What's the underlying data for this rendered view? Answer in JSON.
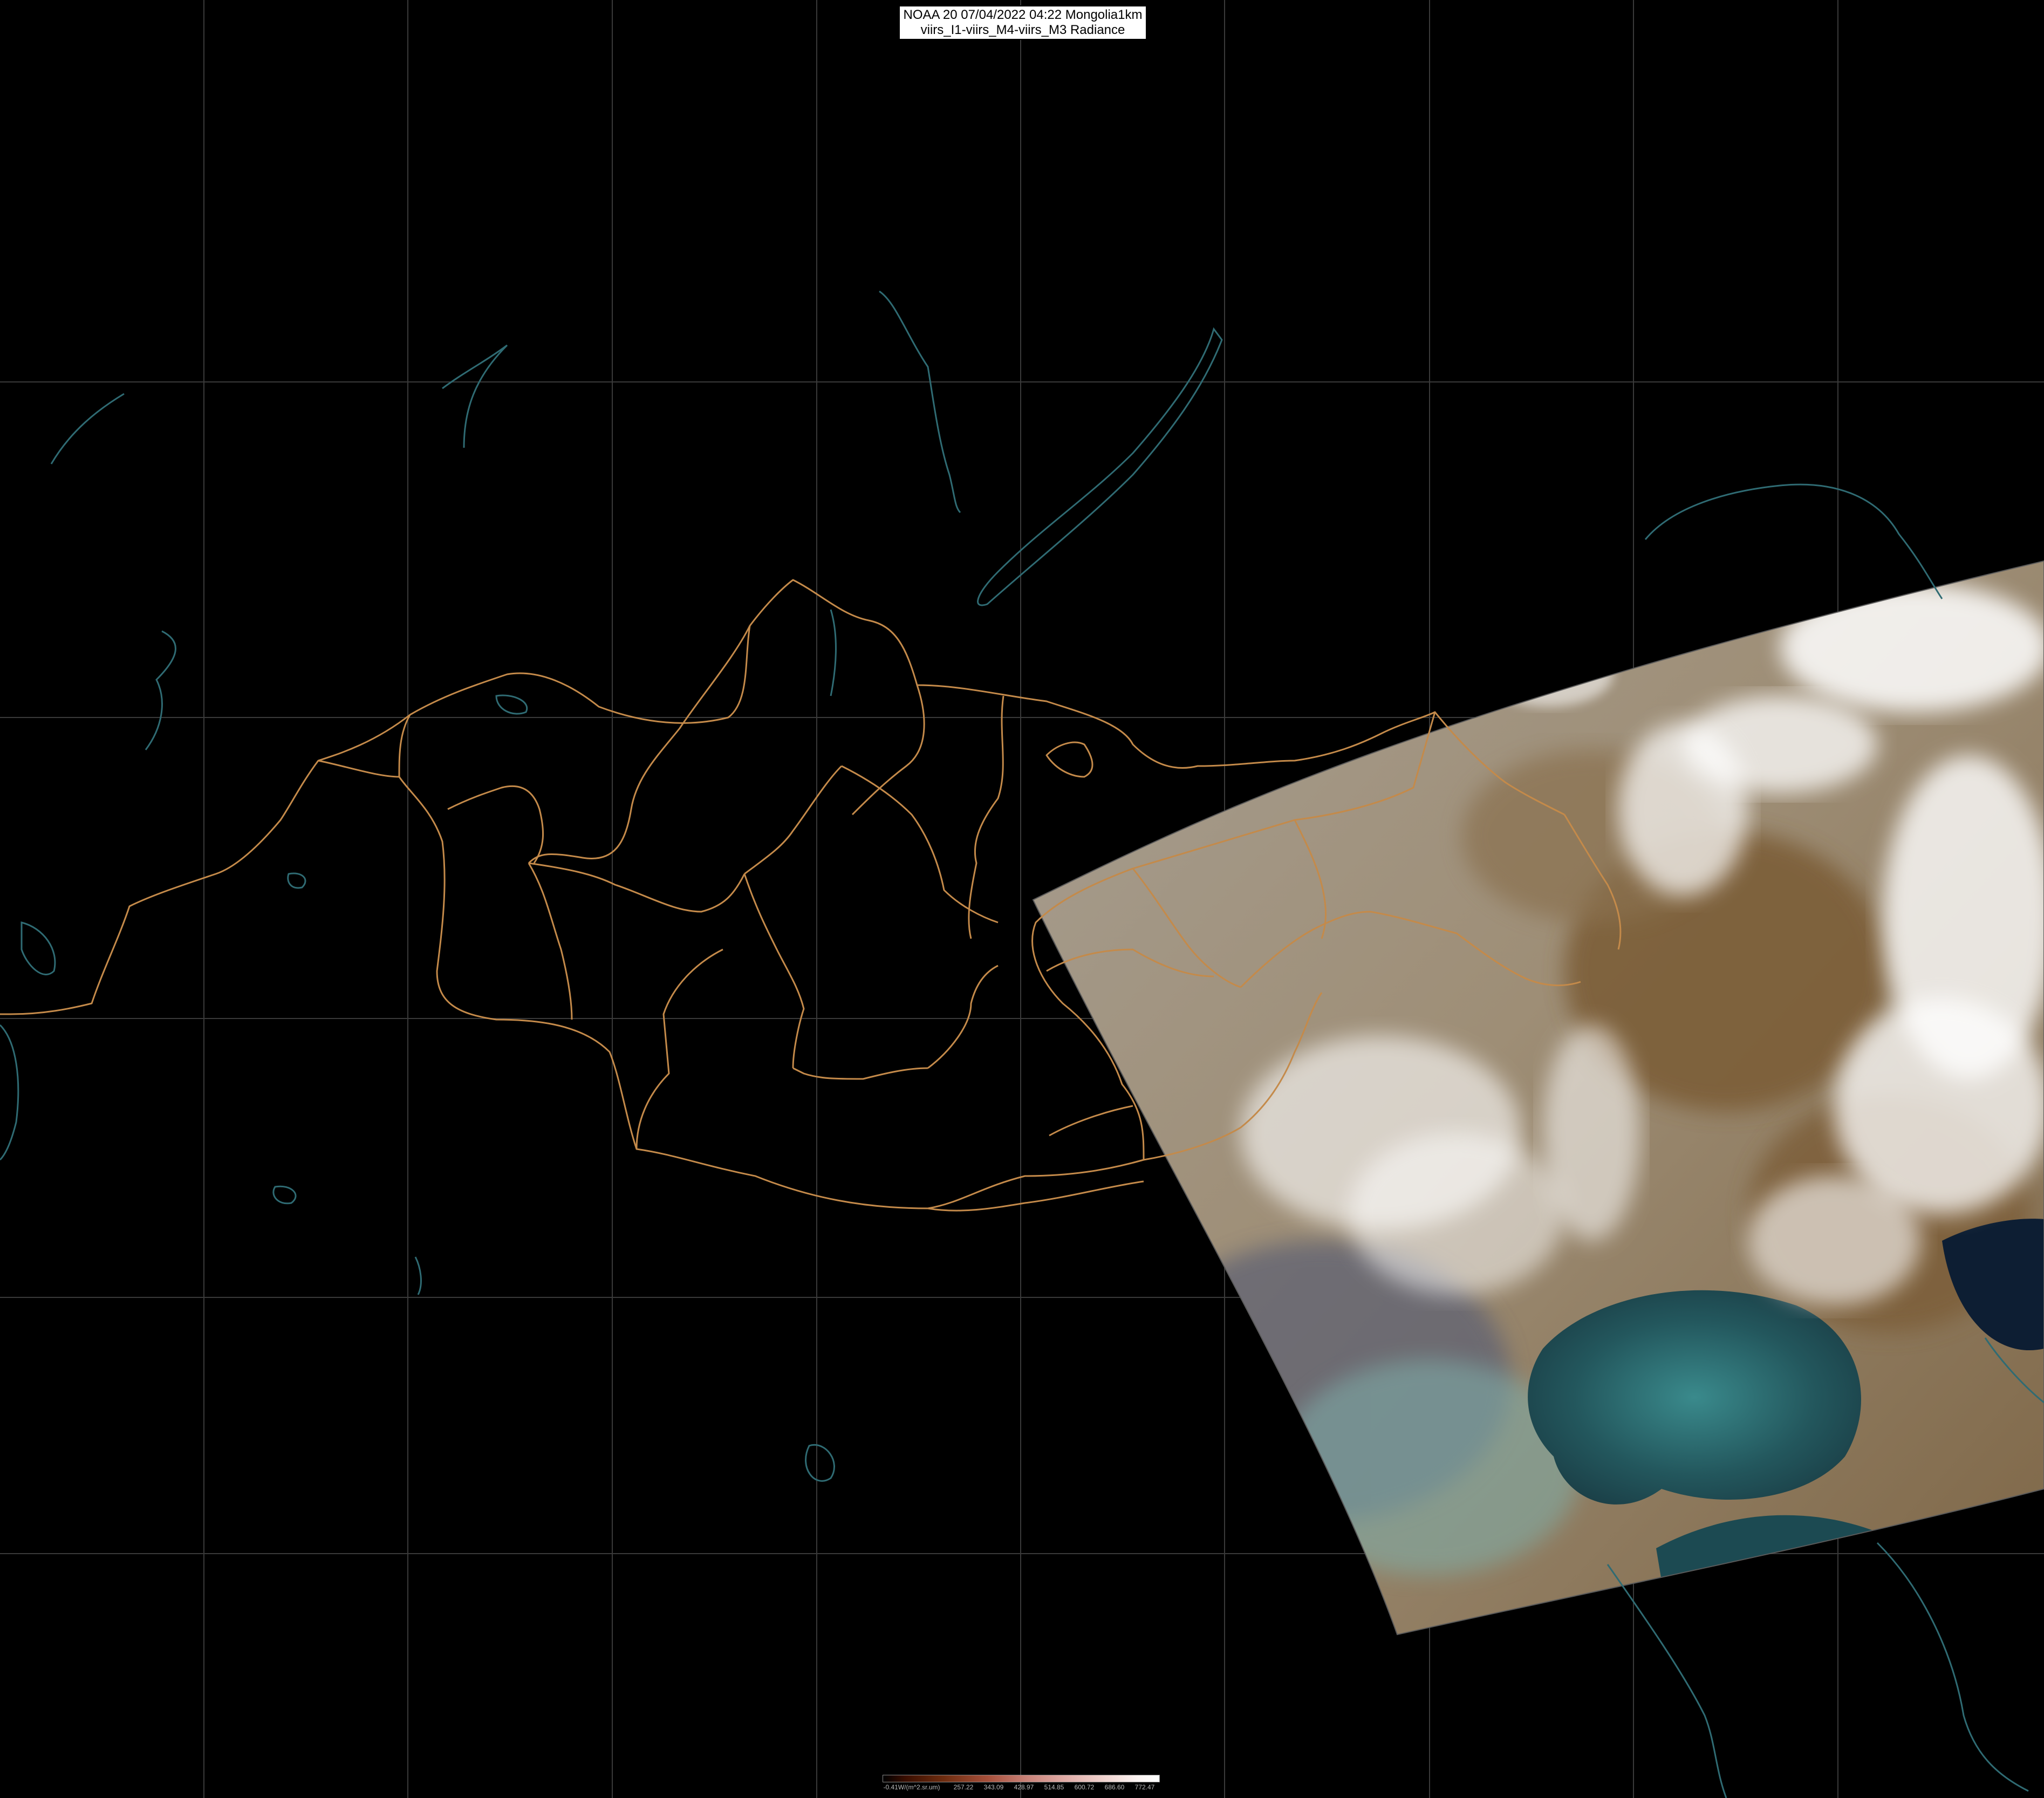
{
  "title": {
    "line1": "NOAA 20 07/04/2022 04:22 Mongolia1km",
    "line2": "viirs_I1-viirs_M4-viirs_M3 Radiance"
  },
  "colorbar": {
    "unit_label": "-0.41W/(m^2.sr.um)",
    "ticks": [
      "257.22",
      "343.09",
      "428.97",
      "514.85",
      "600.72",
      "686.60",
      "772.47"
    ]
  },
  "colors": {
    "background": "#000000",
    "graticule": "#3a3a3a",
    "borders": "#c48a4a",
    "coastlines": "#2f6b73",
    "swath_land": "#a69c8f",
    "sea": "#1f4f55"
  },
  "layers": [
    "graticule",
    "coastlines",
    "admin-borders",
    "satellite-swath",
    "clouds"
  ]
}
